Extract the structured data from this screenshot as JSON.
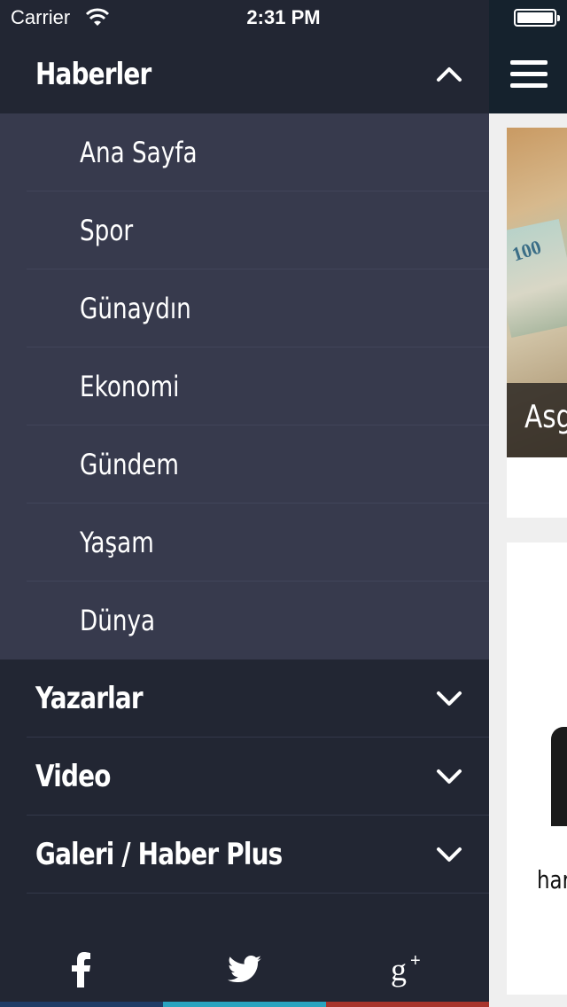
{
  "status_bar": {
    "carrier": "Carrier",
    "time": "2:31 PM"
  },
  "menu": {
    "open_section": {
      "title": "Haberler",
      "state": "expanded",
      "items": [
        {
          "label": "Ana Sayfa"
        },
        {
          "label": "Spor"
        },
        {
          "label": "Günaydın"
        },
        {
          "label": "Ekonomi"
        },
        {
          "label": "Gündem"
        },
        {
          "label": "Yaşam"
        },
        {
          "label": "Dünya"
        }
      ]
    },
    "collapsed_sections": [
      {
        "title": "Yazarlar"
      },
      {
        "title": "Video"
      },
      {
        "title": "Galeri / Haber Plus"
      }
    ]
  },
  "social": [
    {
      "name": "facebook-icon",
      "color": "#3b5998"
    },
    {
      "name": "twitter-icon",
      "color": "#2aa3bf"
    },
    {
      "name": "google-plus-icon",
      "color": "#a8342c"
    }
  ],
  "content": {
    "card1_caption": "Asg",
    "card1_note_text": "100",
    "card2_text": "har"
  },
  "colors": {
    "sidebar_bg": "#222633",
    "submenu_bg": "#373a4d",
    "nav_bg": "#15222d"
  }
}
